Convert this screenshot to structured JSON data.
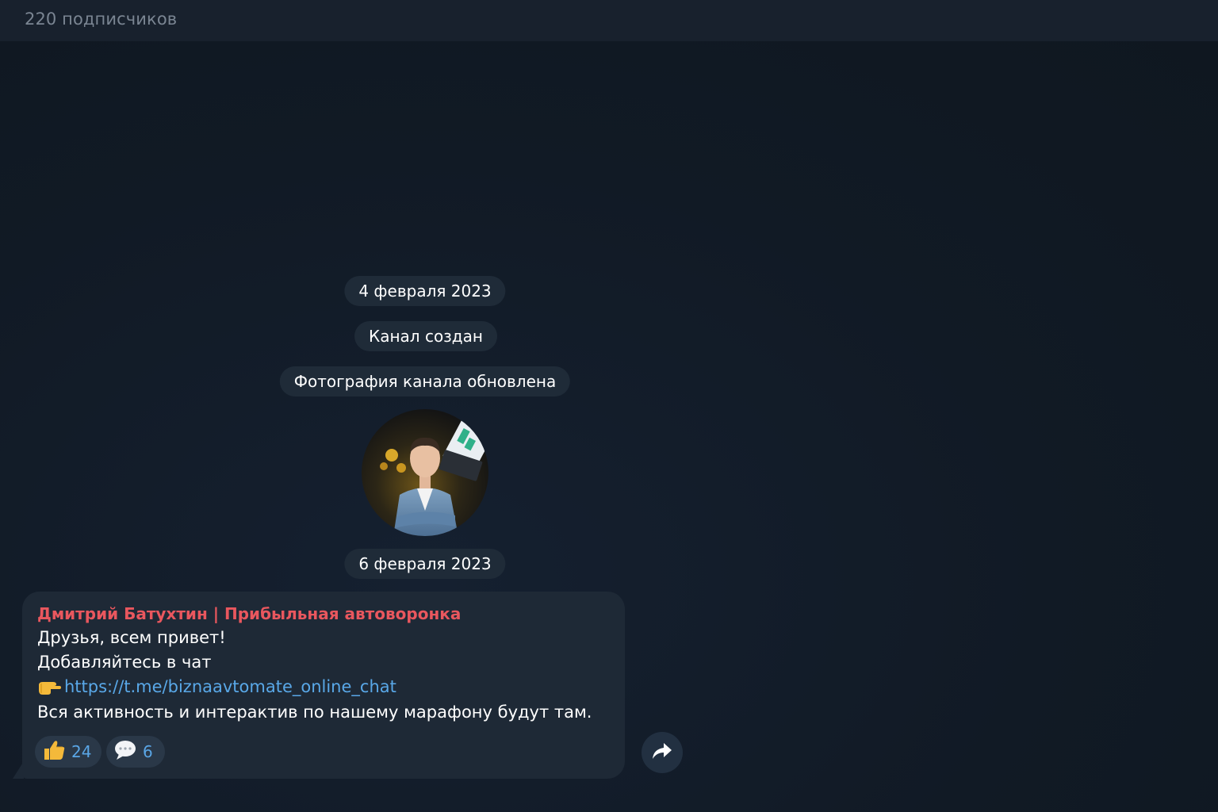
{
  "header": {
    "subscribers": "220 подписчиков"
  },
  "service": {
    "date1": "4 февраля 2023",
    "created": "Канал создан",
    "photo_updated": "Фотография канала обновлена",
    "date2": "6 февраля 2023"
  },
  "message": {
    "sender": "Дмитрий Батухтин | Прибыльная автоворонка",
    "line1": "Друзья, всем привет!",
    "line2": "Добавляйтесь в чат",
    "link": "https://t.me/biznaavtomate_online_chat",
    "line4": "Вся активность и интерактив по нашему марафону будут там.",
    "reactions": [
      {
        "icon": "thumbs-up-icon",
        "count": "24"
      },
      {
        "icon": "speech-balloon-icon",
        "count": "6"
      }
    ]
  },
  "colors": {
    "accent_link": "#59a8e8",
    "sender_name": "#e9575e",
    "background": "#101820"
  }
}
